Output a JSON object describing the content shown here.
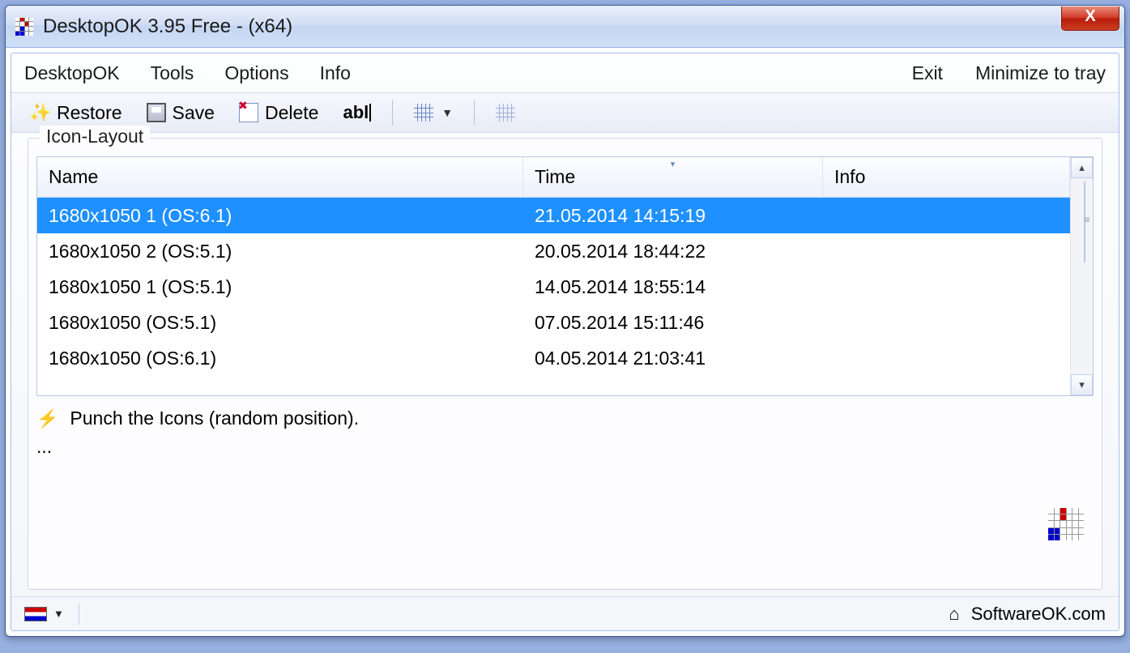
{
  "title": "DesktopOK 3.95 Free - (x64)",
  "menu": {
    "desktopok": "DesktopOK",
    "tools": "Tools",
    "options": "Options",
    "info": "Info",
    "exit": "Exit",
    "minimize": "Minimize to tray"
  },
  "toolbar": {
    "restore": "Restore",
    "save": "Save",
    "delete": "Delete",
    "rename": "abl"
  },
  "group_label": "Icon-Layout",
  "columns": {
    "name": "Name",
    "time": "Time",
    "info": "Info"
  },
  "rows": [
    {
      "name": "1680x1050 1 (OS:6.1)",
      "time": "21.05.2014 14:15:19",
      "info": "",
      "selected": true
    },
    {
      "name": "1680x1050 2 (OS:5.1)",
      "time": "20.05.2014 18:44:22",
      "info": "",
      "selected": false
    },
    {
      "name": "1680x1050 1 (OS:5.1)",
      "time": "14.05.2014 18:55:14",
      "info": "",
      "selected": false
    },
    {
      "name": "1680x1050 (OS:5.1)",
      "time": "07.05.2014 15:11:46",
      "info": "",
      "selected": false
    },
    {
      "name": "1680x1050 (OS:6.1)",
      "time": "04.05.2014 21:03:41",
      "info": "",
      "selected": false
    }
  ],
  "punch_label": "Punch the Icons (random position).",
  "ellipsis": "...",
  "footer_site": "SoftwareOK.com"
}
